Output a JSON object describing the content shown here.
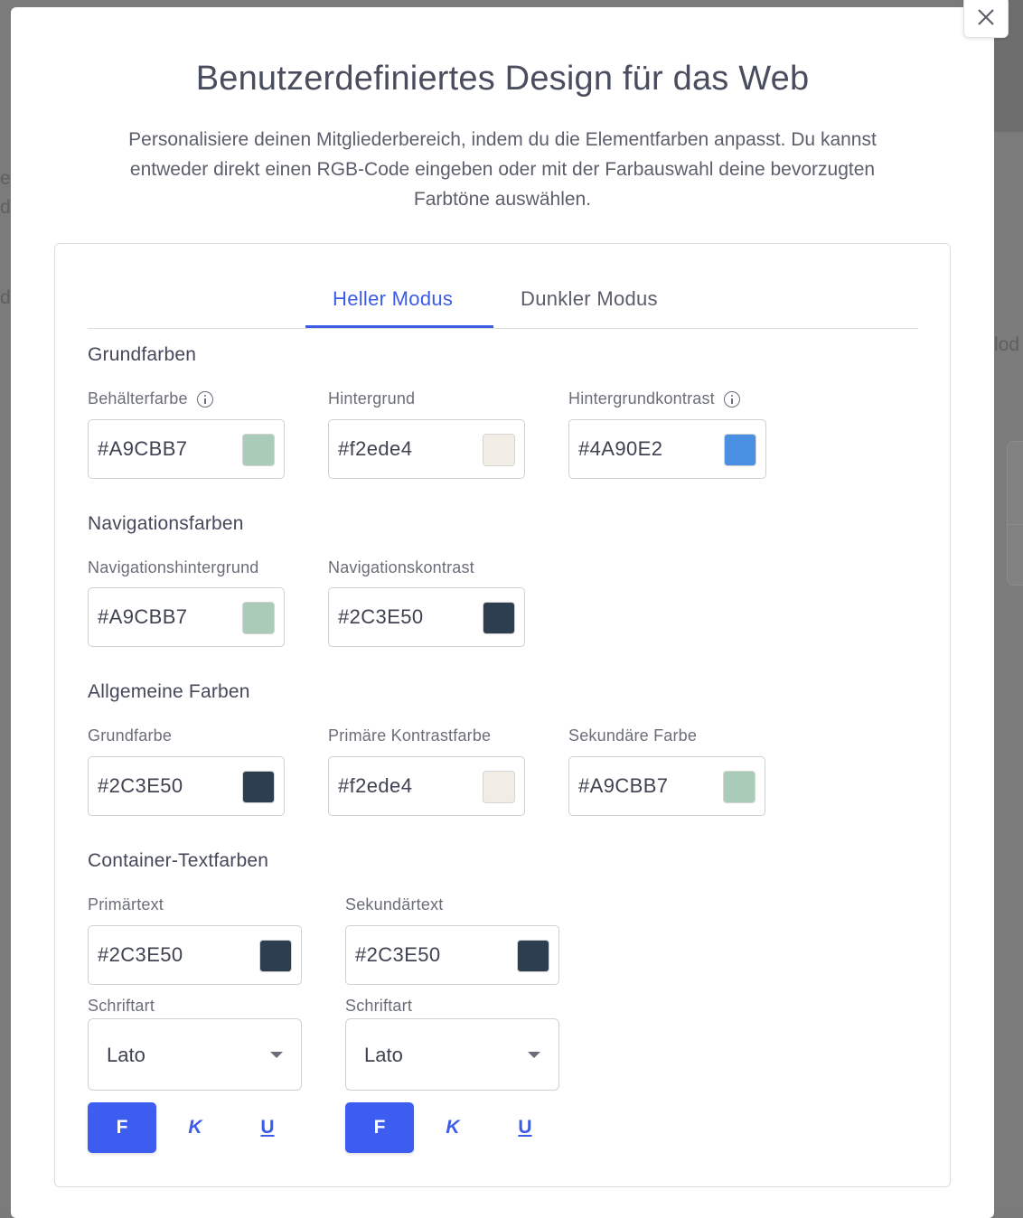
{
  "background": {
    "ghost_texts": [
      "e",
      "d",
      "d",
      "lod"
    ]
  },
  "modal": {
    "title": "Benutzerdefiniertes Design für das Web",
    "subtitle": "Personalisiere deinen Mitgliederbereich, indem du die Elementfarben anpasst. Du kannst entweder direkt einen RGB-Code eingeben oder mit der Farbauswahl deine bevorzugten Farbtöne auswählen.",
    "close_icon": "close-icon"
  },
  "tabs": [
    {
      "label": "Heller Modus",
      "active": true
    },
    {
      "label": "Dunkler Modus",
      "active": false
    }
  ],
  "sections": {
    "base": {
      "title": "Grundfarben",
      "fields": [
        {
          "label": "Behälterfarbe",
          "value": "#A9CBB7",
          "color": "#A9CBB7",
          "info": true
        },
        {
          "label": "Hintergrund",
          "value": "#f2ede4",
          "color": "#f2ede4",
          "info": false
        },
        {
          "label": "Hintergrundkontrast",
          "value": "#4A90E2",
          "color": "#4A90E2",
          "info": true
        }
      ]
    },
    "navigation": {
      "title": "Navigationsfarben",
      "fields": [
        {
          "label": "Navigationshintergrund",
          "value": "#A9CBB7",
          "color": "#A9CBB7"
        },
        {
          "label": "Navigationskontrast",
          "value": "#2C3E50",
          "color": "#2C3E50"
        }
      ]
    },
    "general": {
      "title": "Allgemeine Farben",
      "fields": [
        {
          "label": "Grundfarbe",
          "value": "#2C3E50",
          "color": "#2C3E50"
        },
        {
          "label": "Primäre Kontrastfarbe",
          "value": "#f2ede4",
          "color": "#f2ede4"
        },
        {
          "label": "Sekundäre Farbe",
          "value": "#A9CBB7",
          "color": "#A9CBB7"
        }
      ]
    },
    "container_text": {
      "title": "Container-Textfarben",
      "columns": [
        {
          "label": "Primärtext",
          "value": "#2C3E50",
          "color": "#2C3E50",
          "font_label": "Schriftart",
          "font_value": "Lato",
          "bold": "F",
          "italic": "K",
          "underline": "U"
        },
        {
          "label": "Sekundärtext",
          "value": "#2C3E50",
          "color": "#2C3E50",
          "font_label": "Schriftart",
          "font_value": "Lato",
          "bold": "F",
          "italic": "K",
          "underline": "U"
        }
      ]
    }
  },
  "colors": {
    "accent": "#3d5ce6",
    "bold_button": "#3d5cf0"
  }
}
